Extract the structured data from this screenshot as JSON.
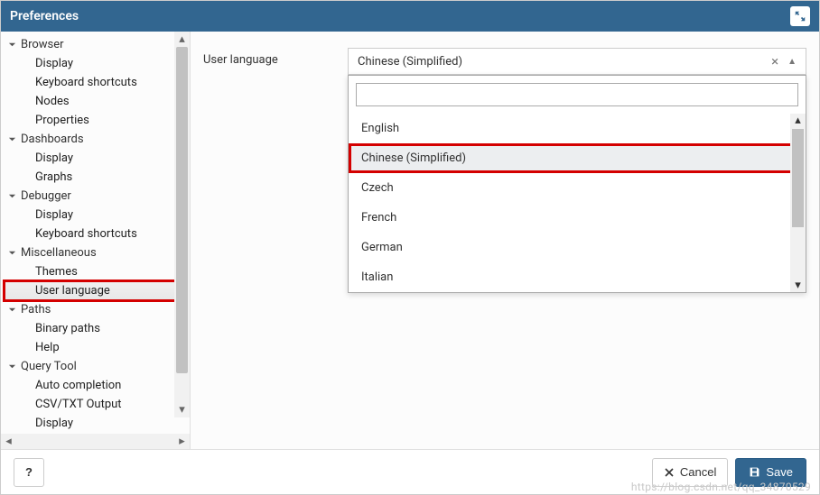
{
  "dialog": {
    "title": "Preferences"
  },
  "sidebar": {
    "groups": [
      {
        "label": "Browser",
        "items": [
          "Display",
          "Keyboard shortcuts",
          "Nodes",
          "Properties"
        ]
      },
      {
        "label": "Dashboards",
        "items": [
          "Display",
          "Graphs"
        ]
      },
      {
        "label": "Debugger",
        "items": [
          "Display",
          "Keyboard shortcuts"
        ]
      },
      {
        "label": "Miscellaneous",
        "items": [
          "Themes",
          "User language"
        ],
        "selectedIndex": 1
      },
      {
        "label": "Paths",
        "items": [
          "Binary paths",
          "Help"
        ]
      },
      {
        "label": "Query Tool",
        "items": [
          "Auto completion",
          "CSV/TXT Output",
          "Display"
        ]
      }
    ]
  },
  "field": {
    "label": "User language",
    "value": "Chinese (Simplified)",
    "options": [
      "English",
      "Chinese (Simplified)",
      "Czech",
      "French",
      "German",
      "Italian"
    ]
  },
  "footer": {
    "help": "?",
    "cancel": "Cancel",
    "save": "Save"
  },
  "watermark": "https://blog.csdn.net/qq_34870529"
}
